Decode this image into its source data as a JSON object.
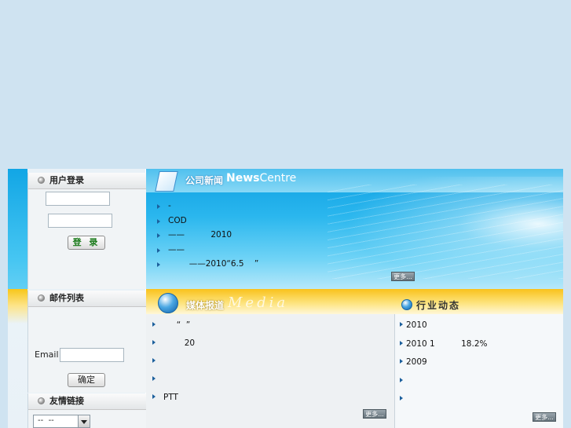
{
  "login": {
    "header": "用户登录",
    "username_value": "",
    "password_value": "",
    "submit_label": "登 录"
  },
  "mail": {
    "header": "邮件列表",
    "email_label": "Email",
    "email_value": "",
    "confirm_label": "确定"
  },
  "links": {
    "header": "友情链接",
    "select_value": "--  --"
  },
  "news": {
    "title_cn": "公司新闻",
    "title_en_a": "News",
    "title_en_b": "Centre",
    "items": [
      "-",
      "COD",
      "——          2010",
      "——",
      "        ——2010“6.5    ”"
    ],
    "more_label": "更多..."
  },
  "media": {
    "title_cn": "媒体报道",
    "title_en": "Media",
    "items": [
      "     “  ”",
      "        20",
      "",
      "",
      "PTT"
    ],
    "more_label": "更多..."
  },
  "industry": {
    "title_cn": "行业动态",
    "items": [
      "2010",
      "2010 1          18.2%",
      "2009",
      "",
      ""
    ],
    "more_label": "更多..."
  }
}
